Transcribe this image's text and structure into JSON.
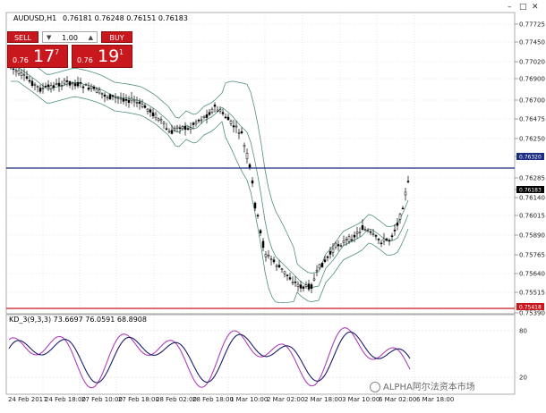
{
  "window": {
    "minimize": "–",
    "restore": "□",
    "close": "✕"
  },
  "chart": {
    "symbol": "AUDUSD,H1",
    "ohlc": "0.76181 0.76248 0.76151 0.76183",
    "indicator_label": "KD_3(9,3,3) 73.6697 76.0591 68.8908"
  },
  "trade": {
    "sell_label": "SELL",
    "buy_label": "BUY",
    "lot": "1.00",
    "sell_small": "0.76",
    "sell_big": "17",
    "sell_sup": "7",
    "buy_small": "0.76",
    "buy_big": "19",
    "buy_sup": "1"
  },
  "price_axis": {
    "ticks": [
      "0.77725",
      "0.77450",
      "0.77020",
      "0.76900",
      "0.76700",
      "0.76475",
      "0.76250",
      "0.76320",
      "0.76285",
      "0.76183",
      "0.76140",
      "0.76015",
      "0.75890",
      "0.75765",
      "0.75640",
      "0.75515",
      "0.75418",
      "0.75390"
    ],
    "tick_values": [
      0.77725,
      0.7745,
      0.7702,
      0.769,
      0.767,
      0.76475,
      0.7625,
      0.7632,
      0.76285,
      0.76183,
      0.7614,
      0.76015,
      0.7589,
      0.75765,
      0.7564,
      0.75515,
      0.75418,
      0.7539
    ],
    "highlight_blue": "0.76320",
    "highlight_black": "0.76183",
    "highlight_red": "0.75418"
  },
  "indicator_axis": {
    "ticks": [
      "80",
      "20"
    ]
  },
  "time_axis": {
    "labels": [
      "24 Feb 2017",
      "24 Feb 18:00",
      "27 Feb 10:00",
      "27 Feb 18:00",
      "28 Feb 02:00",
      "28 Feb 18:00",
      "1 Mar 10:00",
      "2 Mar 02:00",
      "2 Mar 18:00",
      "3 Mar 10:00",
      "6 Mar 02:00",
      "6 Mar 18:00"
    ]
  },
  "watermark": {
    "text": "ALPHA阿尔法资本市场"
  },
  "colors": {
    "sell_buy": "#c8181e",
    "candle": "#000000",
    "bollinger": "#4e8f76",
    "blue_line": "#1c2c80",
    "red_line": "#c8181e",
    "k_line": "#b13fb8",
    "d_line": "#1c1c6b"
  }
}
